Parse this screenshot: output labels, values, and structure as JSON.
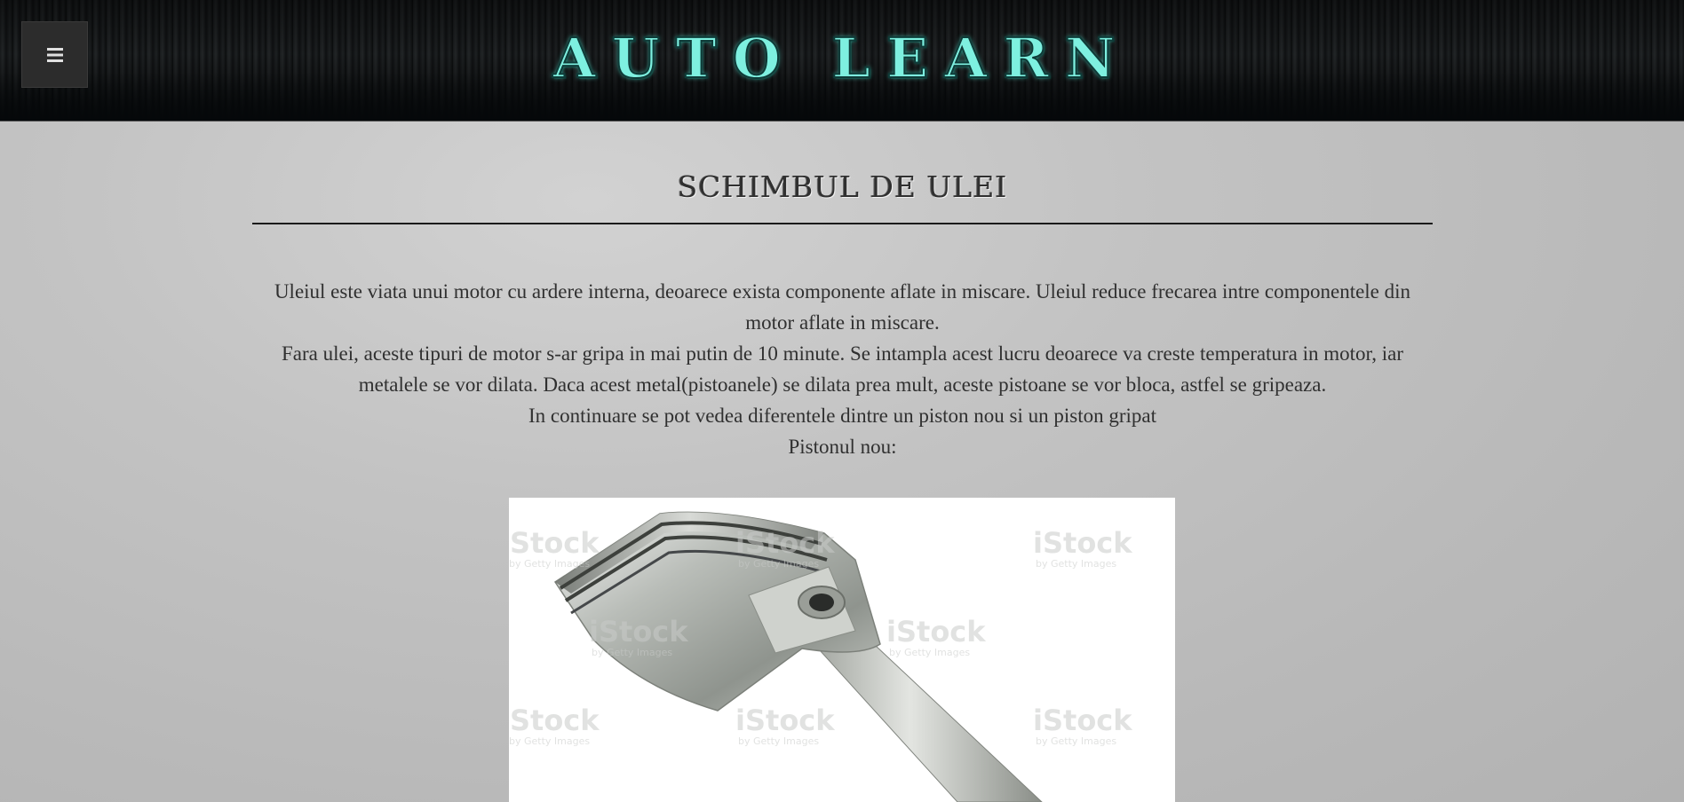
{
  "header": {
    "logo_text": "AUTO LEARN",
    "menu_icon": "hamburger-icon",
    "menu_glyph": "≡"
  },
  "main": {
    "title": "SCHIMBUL DE ULEI",
    "paragraphs": [
      "Uleiul este viata unui motor cu ardere interna, deoarece exista componente aflate in miscare. Uleiul reduce frecarea intre componentele din motor aflate in miscare.",
      "Fara ulei, aceste tipuri de motor s-ar gripa in mai putin de 10 minute. Se intampla acest lucru deoarece va creste temperatura in motor, iar metalele se vor dilata. Daca acest metal(pistoanele) se dilata prea mult, aceste pistoane se vor bloca, astfel se gripeaza.",
      "In continuare se pot vedea diferentele dintre un piston nou si un piston gripat",
      "Pistonul nou:"
    ],
    "image": {
      "watermark": "iStock",
      "watermark_sub": "by Getty Images"
    }
  },
  "colors": {
    "logo": "#7ef0e0",
    "background": "#c3c3c3",
    "text": "#303030",
    "divider": "#1a1a1a"
  }
}
